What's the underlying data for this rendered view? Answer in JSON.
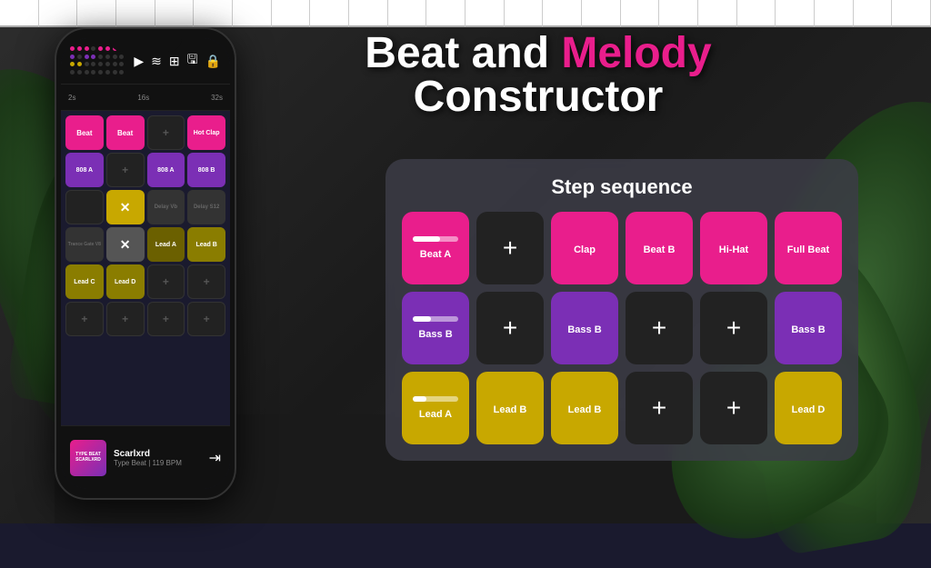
{
  "app": {
    "title_part1": "Beat and ",
    "title_melody": "Melody",
    "title_line2": "Constructor"
  },
  "step_sequence": {
    "title": "Step sequence",
    "pads": [
      {
        "id": "beat-a",
        "label": "Beat A",
        "type": "pink",
        "has_slider": true,
        "slider_fill": 60
      },
      {
        "id": "add-1",
        "label": "+",
        "type": "dark"
      },
      {
        "id": "clap",
        "label": "Clap",
        "type": "pink"
      },
      {
        "id": "beat-b",
        "label": "Beat B",
        "type": "pink"
      },
      {
        "id": "hi-hat",
        "label": "Hi-Hat",
        "type": "pink"
      },
      {
        "id": "full-beat",
        "label": "Full Beat",
        "type": "pink"
      },
      {
        "id": "bass-b-1",
        "label": "Bass B",
        "type": "purple",
        "has_slider": true,
        "slider_fill": 40
      },
      {
        "id": "add-2",
        "label": "+",
        "type": "dark"
      },
      {
        "id": "bass-b-2",
        "label": "Bass B",
        "type": "purple"
      },
      {
        "id": "add-3",
        "label": "+",
        "type": "dark"
      },
      {
        "id": "add-4",
        "label": "+",
        "type": "dark"
      },
      {
        "id": "bass-b-3",
        "label": "Bass B",
        "type": "purple"
      },
      {
        "id": "lead-a",
        "label": "Lead A",
        "type": "yellow",
        "has_slider": true,
        "slider_fill": 30
      },
      {
        "id": "lead-b-1",
        "label": "Lead B",
        "type": "yellow"
      },
      {
        "id": "lead-b-2",
        "label": "Lead B",
        "type": "yellow"
      },
      {
        "id": "add-5",
        "label": "+",
        "type": "dark"
      },
      {
        "id": "add-6",
        "label": "+",
        "type": "dark"
      },
      {
        "id": "lead-d",
        "label": "Lead D",
        "type": "yellow"
      }
    ]
  },
  "phone": {
    "track_name": "Scarlxrd",
    "track_sub": "Type Beat | 119 BPM",
    "pads": [
      {
        "label": "Beat",
        "type": "pink"
      },
      {
        "label": "Beat",
        "type": "pink"
      },
      {
        "label": "+",
        "type": "dark"
      },
      {
        "label": "Hot Clap",
        "type": "pink"
      },
      {
        "label": "808 A",
        "type": "purple"
      },
      {
        "label": "+",
        "type": "dark"
      },
      {
        "label": "808 A",
        "type": "purple"
      },
      {
        "label": "808 B",
        "type": "purple"
      },
      {
        "label": "",
        "type": "dark"
      },
      {
        "label": "✕",
        "type": "cross"
      },
      {
        "label": "Delay Vb",
        "type": "muted"
      },
      {
        "label": "Delay S12",
        "type": "muted"
      },
      {
        "label": "Trance Gate V8",
        "type": "muted"
      },
      {
        "label": "✕",
        "type": "cross2"
      },
      {
        "label": "Lead A",
        "type": "gold"
      },
      {
        "label": "Lead B",
        "type": "gold"
      },
      {
        "label": "Lead C",
        "type": "gold"
      },
      {
        "label": "Lead D",
        "type": "gold"
      },
      {
        "label": "+",
        "type": "dark"
      },
      {
        "label": "+",
        "type": "dark"
      },
      {
        "label": "+",
        "type": "dark"
      },
      {
        "label": "+",
        "type": "dark"
      },
      {
        "label": "+",
        "type": "dark"
      },
      {
        "label": "+",
        "type": "dark"
      },
      {
        "label": "+",
        "type": "dark"
      },
      {
        "label": "+",
        "type": "dark"
      },
      {
        "label": "+",
        "type": "dark"
      },
      {
        "label": "+",
        "type": "dark"
      },
      {
        "label": "+",
        "type": "dark"
      },
      {
        "label": "+",
        "type": "dark"
      },
      {
        "label": "+",
        "type": "dark"
      },
      {
        "label": "+",
        "type": "dark"
      },
      {
        "label": "+",
        "type": "dark"
      },
      {
        "label": "+",
        "type": "dark"
      }
    ]
  }
}
